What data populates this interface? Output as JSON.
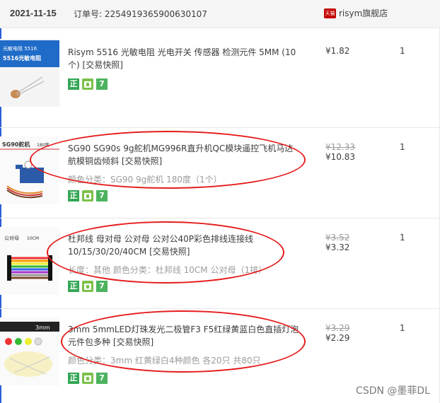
{
  "header": {
    "date": "2021-11-15",
    "order_label": "订单号: ",
    "order_number": "2254919365900630107",
    "tmall_badge": "天猫",
    "shop_name": "risym旗舰店"
  },
  "items": [
    {
      "title": "Risym 5516 光敏电阻 光电开关 传感器 检测元件 5MM (10个)",
      "snapshot": "[交易快照]",
      "props": "",
      "original_price": "",
      "price": "¥1.82",
      "qty": "1",
      "thumb_text": "5516光敏电阻 光电开关"
    },
    {
      "title": "SG90 SG90s 9g舵机MG996R直升机QC模块遥控飞机马达航模铜齿倾斜",
      "snapshot": "[交易快照]",
      "props": "颜色分类：SG90 9g舵机 180度（1个）",
      "original_price": "¥12.33",
      "price": "¥10.83",
      "qty": "1",
      "thumb_text": "SG90舵机 180度"
    },
    {
      "title": "杜邦线 母对母 公对母 公对公40P彩色排线连接线10/15/30/20/40CM",
      "snapshot": "[交易快照]",
      "props": "长度：其他   颜色分类：杜邦线 10CM 公对母（1排）",
      "original_price": "¥3.52",
      "price": "¥3.32",
      "qty": "1",
      "thumb_text": "公对母 10CM"
    },
    {
      "title": "3mm 5mmLED灯珠发光二极管F3 F5红绿黄蓝白色直插灯泡元件包多种",
      "snapshot": "[交易快照]",
      "props": "颜色分类：3mm 红黄绿白4种颜色 各20只 共80只",
      "original_price": "¥3.29",
      "price": "¥2.29",
      "qty": "1",
      "thumb_text": "3mm"
    }
  ],
  "badges": {
    "zheng": "正",
    "seven": "7"
  },
  "watermark": "CSDN @墨菲DL",
  "colors": {
    "annotation_red": "#e51c1c",
    "header_bg": "#f5f5f5"
  }
}
